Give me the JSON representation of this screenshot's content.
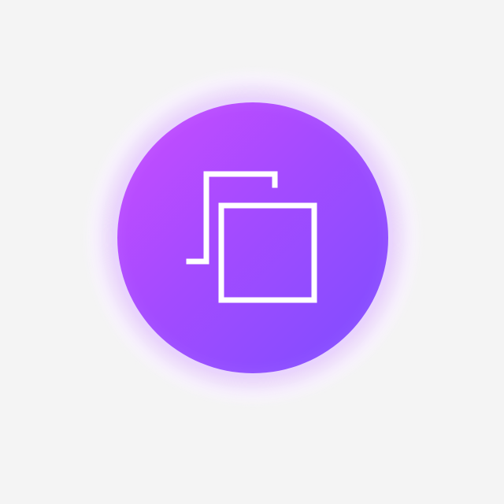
{
  "ui": {
    "button": {
      "icon": "copy-icon",
      "colors": {
        "background": "#f4f4f4",
        "gradient_start": "#c94cff",
        "gradient_end": "#7d4dff",
        "icon_stroke": "#ffffff"
      }
    }
  }
}
